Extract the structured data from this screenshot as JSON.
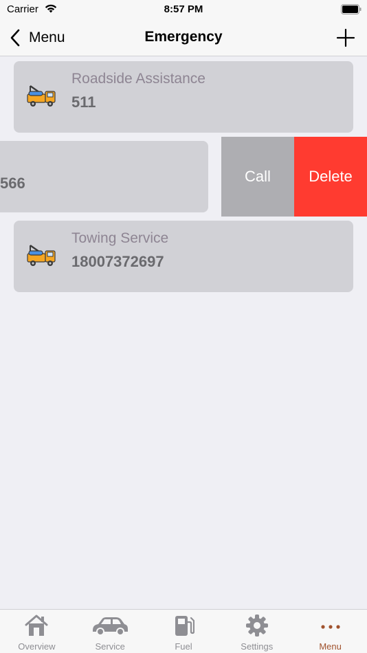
{
  "status_bar": {
    "carrier": "Carrier",
    "time": "8:57 PM"
  },
  "nav": {
    "back_label": "Menu",
    "title": "Emergency",
    "add_icon": "plus-icon"
  },
  "contacts": [
    {
      "name": "Roadside Assistance",
      "number": "511",
      "icon": "tow-truck-icon"
    },
    {
      "name": "",
      "number": "566",
      "icon": "tow-truck-icon",
      "swiped": true
    },
    {
      "name": "Towing Service",
      "number": "18007372697",
      "icon": "tow-truck-icon"
    }
  ],
  "swipe_actions": {
    "call_label": "Call",
    "delete_label": "Delete",
    "call_color": "#aeaeb2",
    "delete_color": "#ff3b30"
  },
  "tabs": [
    {
      "label": "Overview",
      "icon": "house-icon"
    },
    {
      "label": "Service",
      "icon": "car-icon"
    },
    {
      "label": "Fuel",
      "icon": "fuel-pump-icon"
    },
    {
      "label": "Settings",
      "icon": "gear-icon"
    },
    {
      "label": "Menu",
      "icon": "more-dots-icon",
      "active": true
    }
  ],
  "colors": {
    "accent": "#a0522d",
    "card_bg": "#d1d1d6",
    "background": "#efeff4"
  }
}
